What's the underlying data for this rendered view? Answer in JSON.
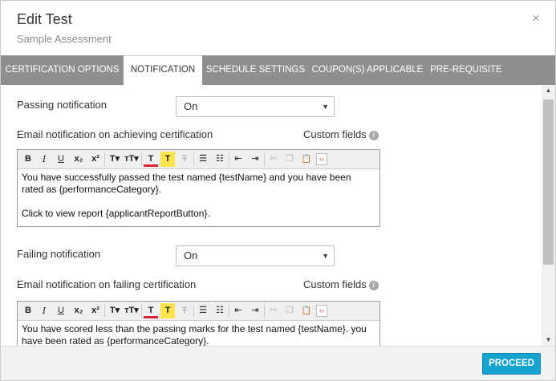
{
  "dialog": {
    "title": "Edit Test",
    "subtitle": "Sample Assessment",
    "close_glyph": "×"
  },
  "tabs": [
    {
      "label": "CERTIFICATION OPTIONS",
      "active": false
    },
    {
      "label": "NOTIFICATION",
      "active": true
    },
    {
      "label": "SCHEDULE SETTINGS",
      "active": false
    },
    {
      "label": "COUPON(S) APPLICABLE",
      "active": false
    },
    {
      "label": "PRE-REQUISITE",
      "active": false
    }
  ],
  "passing": {
    "label": "Passing notification",
    "select_value": "On",
    "email_label": "Email notification on achieving certification",
    "custom_fields": "Custom fields",
    "editor_lines": [
      "You have successfully passed the test named {testName} and you have been rated as {performanceCategory}.",
      "Click to view report {applicantReportButton}."
    ]
  },
  "failing": {
    "label": "Failing notification",
    "select_value": "On",
    "email_label": "Email notification on failing certification",
    "custom_fields": "Custom fields",
    "editor_lines": [
      "You have scored less than the passing marks for the test named {testName}. you have been rated as {performanceCategory}."
    ]
  },
  "toolbar": {
    "bold": "B",
    "italic": "I",
    "underline": "U",
    "subscript": "x₂",
    "superscript": "x²",
    "font_family": "T▾",
    "font_size": "тT▾",
    "text_color": "T",
    "bg_color": "T",
    "remove_format": "T",
    "bullet_list": "☰",
    "numbered_list": "☷",
    "outdent": "⇤",
    "indent": "⇥",
    "cut": "✂",
    "copy": "❐",
    "paste": "📋",
    "source": "‹›"
  },
  "footer": {
    "proceed_label": "PROCEED"
  },
  "colors": {
    "tab_bar": "#8f8f8f",
    "accent": "#16a3cf",
    "footer_bg": "#f2f2f2"
  }
}
